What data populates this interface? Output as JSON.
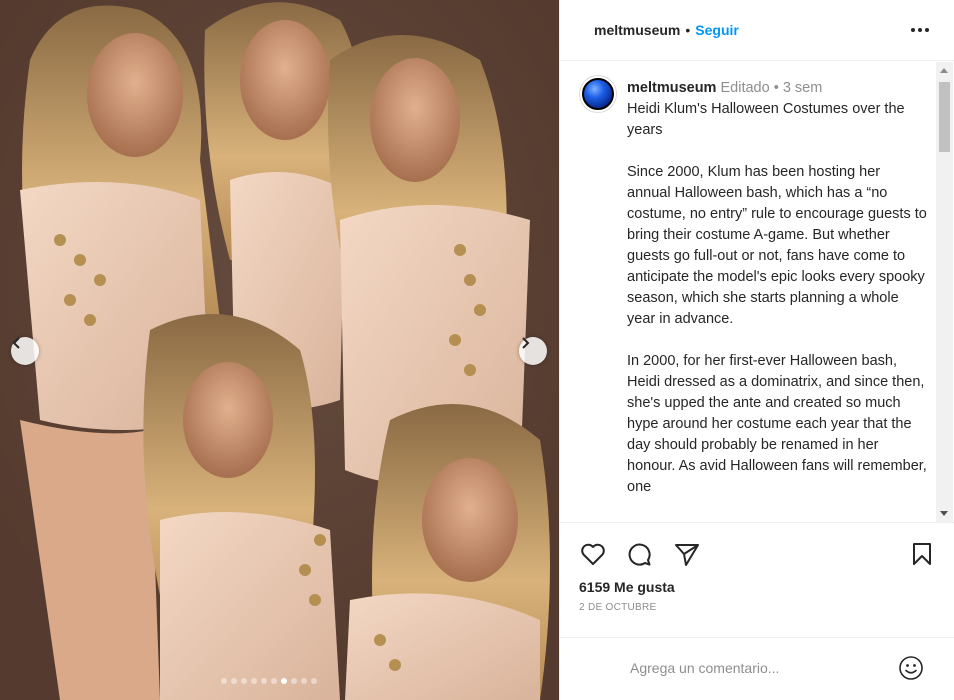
{
  "post": {
    "username": "meltmuseum",
    "follow_label": "Seguir",
    "separator": "•",
    "carousel": {
      "total_slides": 10,
      "active_index": 6
    }
  },
  "caption": {
    "username": "meltmuseum",
    "edited": "Editado",
    "bullet": "•",
    "time": "3 sem",
    "title": "Heidi Klum's Halloween Costumes over the years",
    "para1": "Since 2000, Klum has been hosting her annual Halloween bash, which has a “no costume, no entry” rule to encourage guests to bring their costume A-game. But whether guests go full-out or not, fans have come to anticipate the model's epic looks every spooky season, which she starts planning a whole year in advance.",
    "para2": "In 2000, for her first-ever Halloween bash, Heidi dressed as a dominatrix, and since then, she's upped the ante and created so much hype around her costume each year that the day should probably be renamed in her honour. As avid Halloween fans will remember, one"
  },
  "stats": {
    "likes": "6159 Me gusta",
    "date": "2 DE OCTUBRE"
  },
  "comment": {
    "placeholder": "Agrega un comentario..."
  },
  "icons": {
    "like": "heart-icon",
    "comment": "comment-icon",
    "share": "send-icon",
    "save": "bookmark-icon",
    "more": "more-icon",
    "emoji": "emoji-icon",
    "prev": "chevron-left-icon",
    "next": "chevron-right-icon"
  },
  "colors": {
    "accent": "#0095f6",
    "text": "#262626",
    "muted": "#8e8e8e"
  }
}
